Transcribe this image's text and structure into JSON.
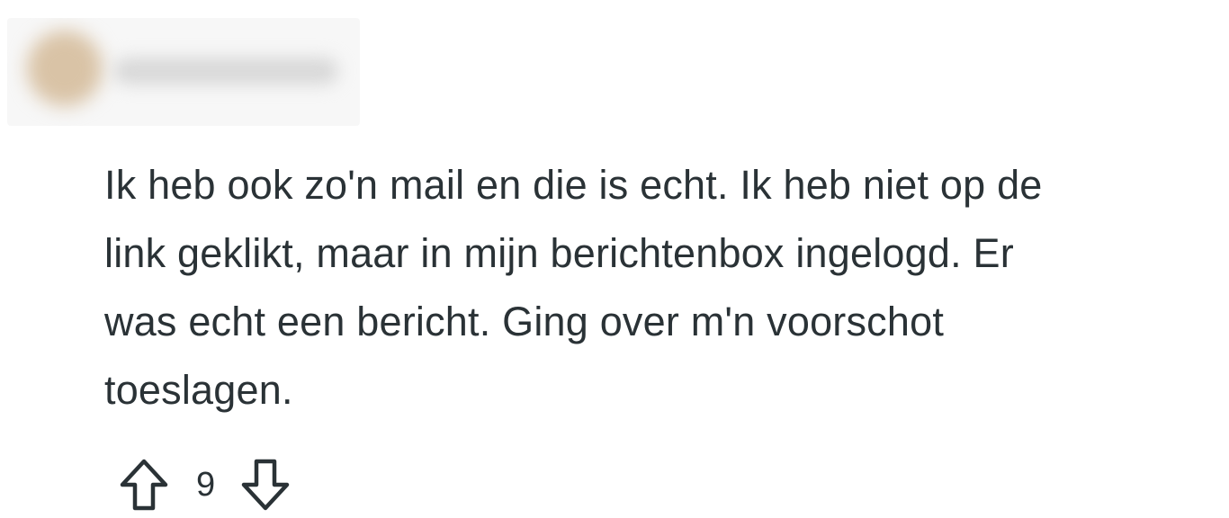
{
  "comment": {
    "lines": [
      "Ik heb ook zo'n mail en die is echt. Ik heb niet op de",
      "link geklikt, maar in mijn berichtenbox ingelogd. Er",
      "was echt een bericht. Ging over m'n voorschot",
      "toeslagen."
    ]
  },
  "votes": {
    "score": "9",
    "upvote_icon": "arrow-up-outline-icon",
    "downvote_icon": "arrow-down-outline-icon"
  },
  "colors": {
    "text": "#2a3236",
    "background": "#ffffff"
  }
}
